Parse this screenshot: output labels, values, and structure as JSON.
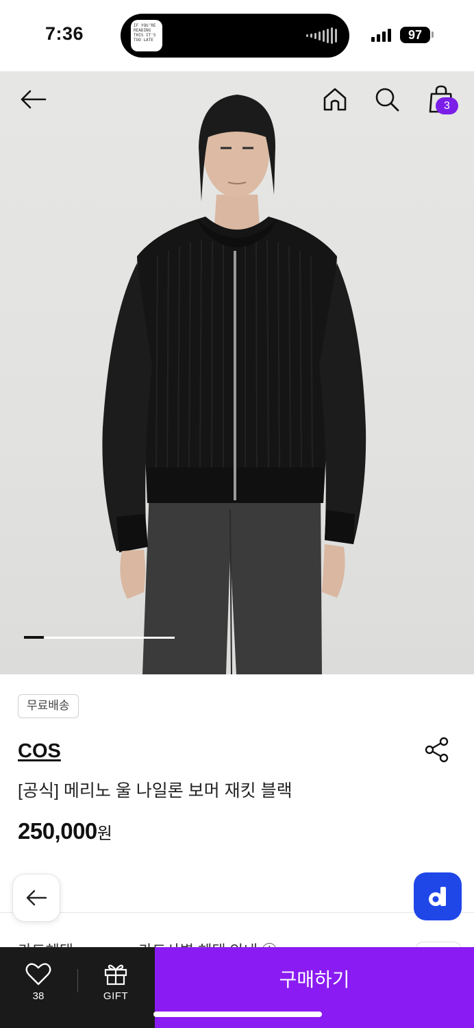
{
  "status_bar": {
    "time": "7:36",
    "battery": "97",
    "island_thumb_text": "IF YOU'RE READING THIS IT'S TOO LATE"
  },
  "header": {
    "cart_count": "3",
    "icons": [
      "back-arrow-icon",
      "home-icon",
      "search-icon",
      "shopping-bag-icon"
    ]
  },
  "gallery": {
    "progress": 0.13
  },
  "product": {
    "free_shipping_badge": "무료배송",
    "brand": "COS",
    "name": "[공식] 메리노 울 나일론 보머 재킷 블랙",
    "price": "250,000",
    "price_unit": "원"
  },
  "peek": {
    "left": "카드혜택",
    "right": "카드사별 혜택 안내 ⓘ"
  },
  "bottom_bar": {
    "like_count": "38",
    "gift_label": "GIFT",
    "buy_label": "구매하기"
  },
  "colors": {
    "accent": "#8a1bf2",
    "badge": "#7b1fe8",
    "app_logo": "#1f47e8"
  }
}
